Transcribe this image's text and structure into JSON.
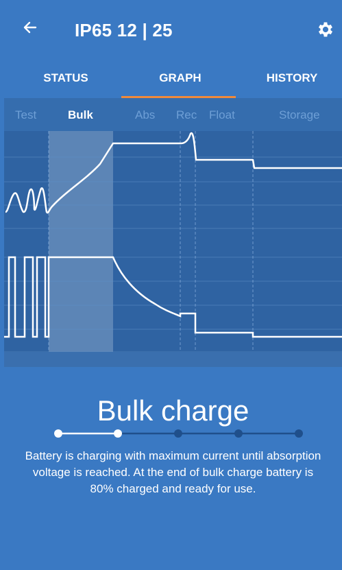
{
  "header": {
    "title": "IP65 12 | 25",
    "back_icon": "arrow-left-icon",
    "settings_icon": "gear-icon"
  },
  "tabs": [
    {
      "label": "STATUS",
      "active": false
    },
    {
      "label": "GRAPH",
      "active": true
    },
    {
      "label": "HISTORY",
      "active": false
    }
  ],
  "phases": [
    {
      "label": "Test",
      "active": false
    },
    {
      "label": "Bulk",
      "active": true
    },
    {
      "label": "Abs",
      "active": false
    },
    {
      "label": "Rec",
      "active": false
    },
    {
      "label": "Float",
      "active": false
    },
    {
      "label": "Storage",
      "active": false
    }
  ],
  "info": {
    "title": "Bulk charge",
    "description": "Battery is charging with maximum current until absorption voltage is reached. At the end of bulk charge battery is 80% charged and ready for use."
  },
  "stepper": {
    "total_steps": 5,
    "current_step": 2
  },
  "colors": {
    "background": "#3a79c3",
    "graph_bg": "#2f63a2",
    "accent": "#f08a3b",
    "dark_dot": "#1f4f8b"
  }
}
